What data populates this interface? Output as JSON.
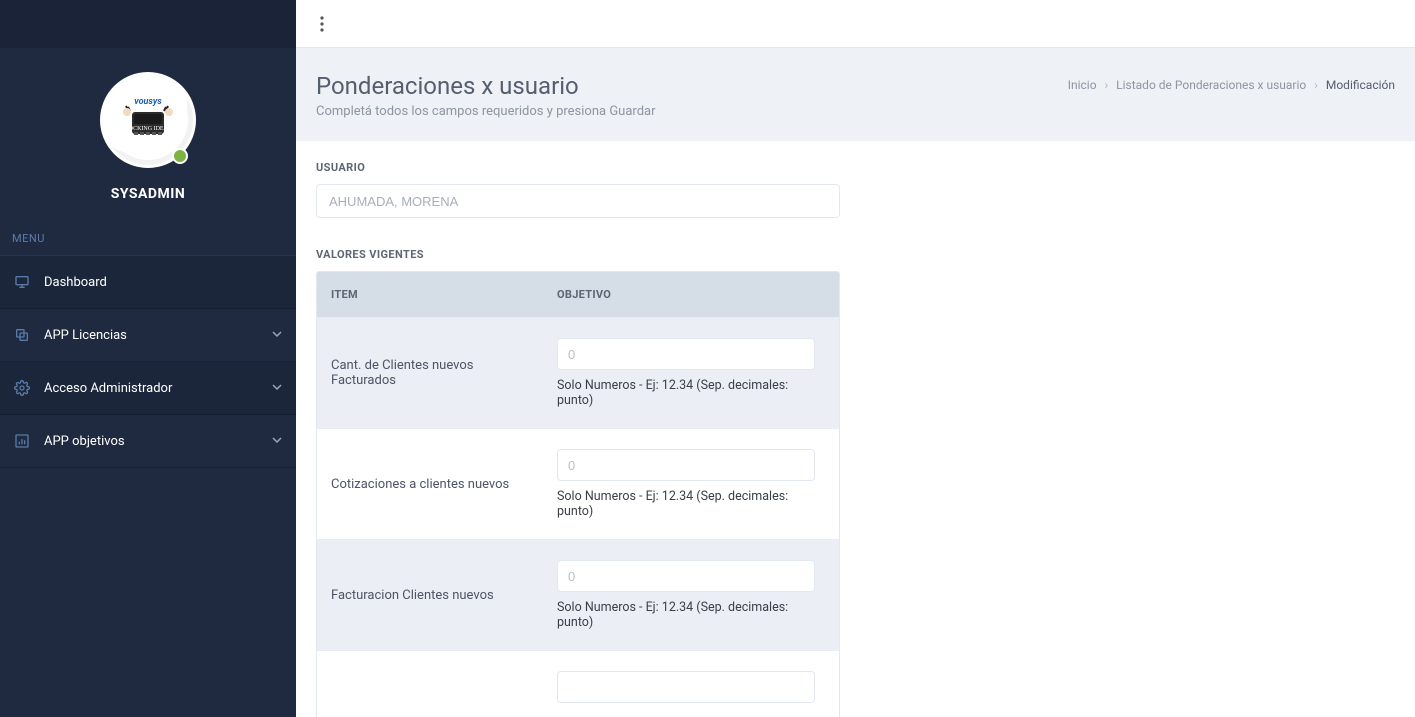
{
  "sidebar": {
    "profile_name": "SYSADMIN",
    "menu_label": "MENU",
    "items": [
      {
        "label": "Dashboard",
        "icon": "monitor-icon",
        "expandable": false
      },
      {
        "label": "APP Licencias",
        "icon": "copy-icon",
        "expandable": true
      },
      {
        "label": "Acceso Administrador",
        "icon": "gear-icon",
        "expandable": true
      },
      {
        "label": "APP objetivos",
        "icon": "bar-chart-icon",
        "expandable": true
      }
    ]
  },
  "breadcrumb": {
    "home": "Inicio",
    "mid": "Listado de Ponderaciones x usuario",
    "current": "Modificación"
  },
  "page": {
    "title": "Ponderaciones x usuario",
    "subtitle": "Completá todos los campos requeridos y presiona Guardar"
  },
  "form": {
    "user_label": "USUARIO",
    "user_value": "AHUMADA, MORENA",
    "values_label": "VALORES VIGENTES",
    "table": {
      "col_item": "ITEM",
      "col_obj": "OBJETIVO",
      "rows": [
        {
          "item": "Cant. de Clientes nuevos Facturados",
          "placeholder": "0",
          "helper": "Solo Numeros - Ej: 12.34 (Sep. decimales: punto)"
        },
        {
          "item": "Cotizaciones a clientes nuevos",
          "placeholder": "0",
          "helper": "Solo Numeros - Ej: 12.34 (Sep. decimales: punto)"
        },
        {
          "item": "Facturacion Clientes nuevos",
          "placeholder": "0",
          "helper": "Solo Numeros - Ej: 12.34 (Sep. decimales: punto)"
        }
      ]
    }
  }
}
